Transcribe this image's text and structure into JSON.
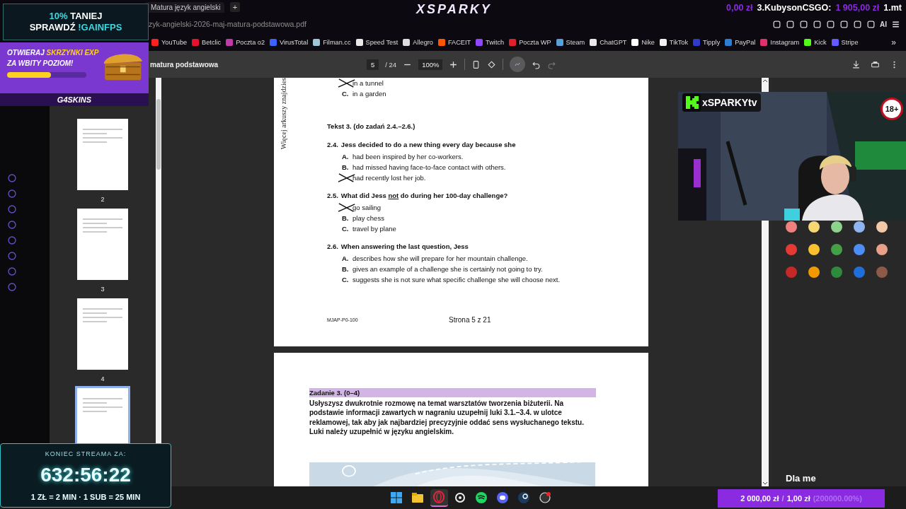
{
  "promo": {
    "line1_accent": "10%",
    "line1": "TANIEJ",
    "line2": "SPRAWDŹ",
    "line2_accent": "!GAINFPS"
  },
  "banner": {
    "lead": "OTWIERAJ",
    "highlight": "SKRZYNKI EXP",
    "line2": "ZA WBITY POZIOM!",
    "level": 0.55,
    "brand": "G4SKINS"
  },
  "logo": "XSPARKY",
  "ticker": [
    {
      "text": "0,00 zł",
      "kind": "amount"
    },
    {
      "text": "3.KubysonCSGO:",
      "kind": "name"
    },
    {
      "text": "1 905,00 zł",
      "kind": "amount"
    },
    {
      "text": "1.mt",
      "kind": "name"
    }
  ],
  "tabs": [
    {
      "label": "Matura język angielski",
      "selected": true
    }
  ],
  "new_tab": "+",
  "address": "zyk-angielski-2026-maj-matura-podstawowa.pdf",
  "toolbar_ai": "AI",
  "bookmarks": [
    {
      "label": "YouTube",
      "color": "#ff2020"
    },
    {
      "label": "Betclic",
      "color": "#e8112d"
    },
    {
      "label": "Poczta o2",
      "color": "#c03aa8"
    },
    {
      "label": "VirusTotal",
      "color": "#3b61ff"
    },
    {
      "label": "Filman.cc",
      "color": "#9fc6d8"
    },
    {
      "label": "Speed Test",
      "color": "#e8e8e8"
    },
    {
      "label": "Allegro",
      "color": "#dddddd"
    },
    {
      "label": "FACEIT",
      "color": "#ff5500"
    },
    {
      "label": "Twitch",
      "color": "#9146ff"
    },
    {
      "label": "Poczta WP",
      "color": "#e0202a"
    },
    {
      "label": "Steam",
      "color": "#5aa0d8"
    },
    {
      "label": "ChatGPT",
      "color": "#e8e8e8"
    },
    {
      "label": "Nike",
      "color": "#ffffff"
    },
    {
      "label": "TikTok",
      "color": "#f0f0f0"
    },
    {
      "label": "Tipply",
      "color": "#2f3cc8"
    },
    {
      "label": "PayPal",
      "color": "#2a7fd4"
    },
    {
      "label": "Instagram",
      "color": "#e1306c"
    },
    {
      "label": "Kick",
      "color": "#53fc18"
    },
    {
      "label": "Stripe",
      "color": "#635bff"
    }
  ],
  "bookmarks_more": "»",
  "pdf_toolbar": {
    "title": "matura podstawowa",
    "page": "5",
    "total": "/ 24",
    "zoom": "100%"
  },
  "thumbnails": [
    {
      "number": "2",
      "selected": false
    },
    {
      "number": "3",
      "selected": false
    },
    {
      "number": "4",
      "selected": false
    },
    {
      "selected": true
    }
  ],
  "page_a": {
    "margin_note": "Więcej arkuszy znajdzies",
    "blocks": [
      {
        "kind": "options",
        "options": [
          {
            "text": "in a tunnel",
            "crossed": true
          },
          {
            "letter": "C.",
            "text": "in a garden",
            "crossed": false
          }
        ]
      },
      {
        "kind": "heading",
        "text": "Tekst 3. (do zadań 2.4.–2.6.)"
      },
      {
        "kind": "question",
        "number": "2.4.",
        "parts": [
          {
            "text": "Jess decided to do a new thing every day because she",
            "underline": false
          }
        ],
        "options": [
          {
            "letter": "A.",
            "text": "had been inspired by her co-workers.",
            "crossed": false
          },
          {
            "letter": "B.",
            "text": "had missed having face-to-face contact with others.",
            "crossed": false
          },
          {
            "text": "had recently lost her job.",
            "crossed": true
          }
        ]
      },
      {
        "kind": "question",
        "number": "2.5.",
        "parts": [
          {
            "text": "What did Jess",
            "underline": false
          },
          {
            "text": "not",
            "underline": true
          },
          {
            "text": "do during her 100-day challenge?",
            "underline": false
          }
        ],
        "options": [
          {
            "text": "go sailing",
            "crossed": true
          },
          {
            "letter": "B.",
            "text": "play chess",
            "crossed": false
          },
          {
            "letter": "C.",
            "text": "travel by plane",
            "crossed": false
          }
        ]
      },
      {
        "kind": "question",
        "number": "2.6.",
        "parts": [
          {
            "text": "When answering the last question, Jess",
            "underline": false
          }
        ],
        "options": [
          {
            "letter": "A.",
            "text": "describes how she will prepare for her mountain challenge.",
            "crossed": false
          },
          {
            "letter": "B.",
            "text": "gives an example of a challenge she is certainly not going to try.",
            "crossed": false
          },
          {
            "letter": "C.",
            "text": "suggests she is not sure what specific challenge she will choose next.",
            "crossed": false
          }
        ]
      }
    ],
    "code": "MJAP-P0-100",
    "page_label": "Strona 5 z 21"
  },
  "page_b": {
    "heading": "Zadanie 3. (0–4)",
    "instructions": "Usłyszysz dwukrotnie rozmowę na temat warsztatów tworzenia biżuterii. Na podstawie informacji zawartych w nagraniu uzupełnij luki 3.1.–3.4. w ulotce reklamowej, tak aby jak najbardziej precyzyjnie oddać sens wysłuchanego tekstu. Luki należy uzupełnić w języku angielskim."
  },
  "webcam": {
    "channel": "xSPARKYtv",
    "badge": "18+"
  },
  "swatches": [
    {
      "color": "#f08080"
    },
    {
      "color": "#f7d774"
    },
    {
      "color": "#8fd18f"
    },
    {
      "color": "#8fb4f0"
    },
    {
      "color": "#f1c8a8"
    },
    {
      "color": "#e53935"
    },
    {
      "color": "#fbc02d"
    },
    {
      "color": "#43a047"
    },
    {
      "color": "#4c8df6"
    },
    {
      "color": "#e8a088"
    },
    {
      "color": "#c62828"
    },
    {
      "color": "#f29900"
    },
    {
      "color": "#2e8b3e"
    },
    {
      "color": "#1e6fd9"
    },
    {
      "color": "#8d5a4a"
    }
  ],
  "chat_text": "Dla me",
  "counter": {
    "title": "KONIEC STREAMA ZA:",
    "time": "632:56:22",
    "rates": "1 ZŁ = 2 MIN · 1 SUB = 25 MIN"
  },
  "goal": {
    "raised": "2 000,00 zł",
    "separator": "/",
    "target": "1,00 zł",
    "percent": "(200000.00%)"
  },
  "taskbar": [
    {
      "kind": "start",
      "selected": false
    },
    {
      "kind": "files",
      "selected": false
    },
    {
      "kind": "browser",
      "selected": true
    },
    {
      "kind": "gear",
      "selected": false
    },
    {
      "kind": "music",
      "selected": false
    },
    {
      "kind": "chat",
      "selected": false
    },
    {
      "kind": "steam",
      "selected": false
    },
    {
      "kind": "recorder",
      "selected": false
    }
  ]
}
